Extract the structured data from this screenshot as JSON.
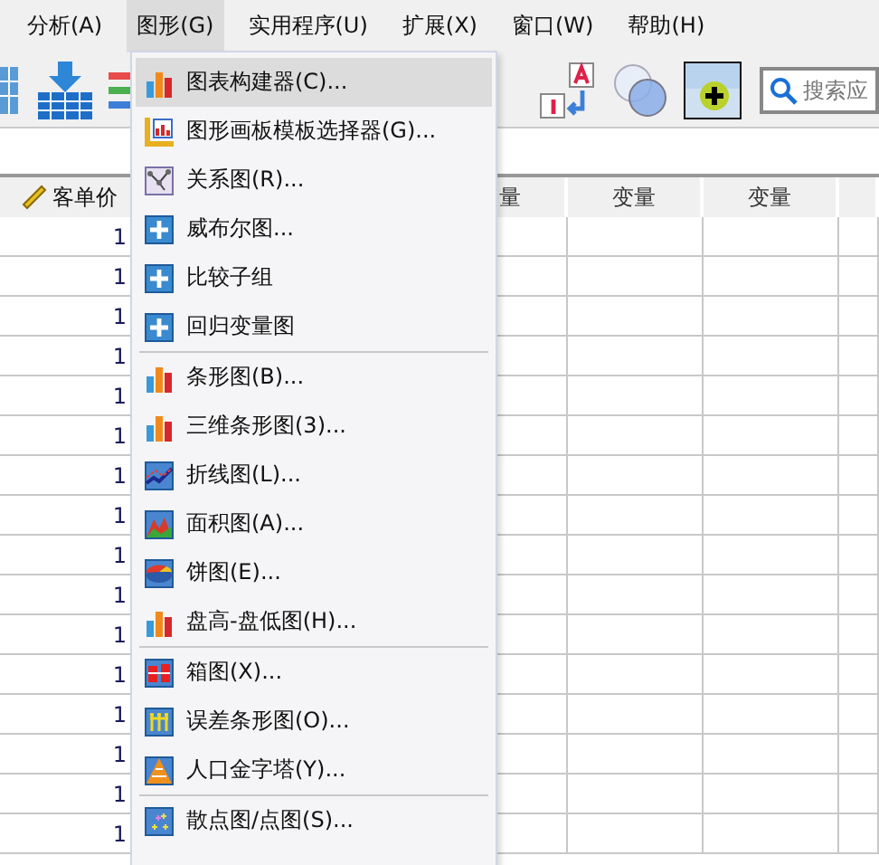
{
  "menubar": [
    {
      "label": "分析(A)",
      "selected": false
    },
    {
      "label": "图形(G)",
      "selected": true
    },
    {
      "label": "实用程序(U)",
      "selected": false
    },
    {
      "label": "扩展(X)",
      "selected": false
    },
    {
      "label": "窗口(W)",
      "selected": false
    },
    {
      "label": "帮助(H)",
      "selected": false
    }
  ],
  "search": {
    "placeholder": "搜索应"
  },
  "grid": {
    "columns": [
      {
        "label": "客单价"
      },
      {
        "label": "量"
      },
      {
        "label": "变量"
      },
      {
        "label": "变量"
      },
      {}
    ],
    "rows": [
      [
        "1"
      ],
      [
        "1"
      ],
      [
        "1"
      ],
      [
        "1"
      ],
      [
        "1"
      ],
      [
        "1"
      ],
      [
        "1"
      ],
      [
        "1"
      ],
      [
        "1"
      ],
      [
        "1"
      ],
      [
        "1"
      ],
      [
        "1"
      ],
      [
        "1"
      ],
      [
        "1"
      ],
      [
        "1"
      ],
      [
        "1"
      ]
    ]
  },
  "menu": {
    "groups": [
      [
        {
          "label": "图表构建器(C)...",
          "selected": true
        },
        {
          "label": "图形画板模板选择器(G)...",
          "selected": false
        },
        {
          "label": "关系图(R)...",
          "selected": false
        },
        {
          "label": "威布尔图...",
          "selected": false
        },
        {
          "label": "比较子组",
          "selected": false
        },
        {
          "label": "回归变量图",
          "selected": false
        }
      ],
      [
        {
          "label": "条形图(B)...",
          "selected": false
        },
        {
          "label": "三维条形图(3)...",
          "selected": false
        },
        {
          "label": "折线图(L)...",
          "selected": false
        },
        {
          "label": "面积图(A)...",
          "selected": false
        },
        {
          "label": "饼图(E)...",
          "selected": false
        },
        {
          "label": "盘高-盘低图(H)...",
          "selected": false
        }
      ],
      [
        {
          "label": "箱图(X)...",
          "selected": false
        },
        {
          "label": "误差条形图(O)...",
          "selected": false
        },
        {
          "label": "人口金字塔(Y)...",
          "selected": false
        }
      ],
      [
        {
          "label": "散点图/点图(S)...",
          "selected": false
        }
      ]
    ]
  }
}
